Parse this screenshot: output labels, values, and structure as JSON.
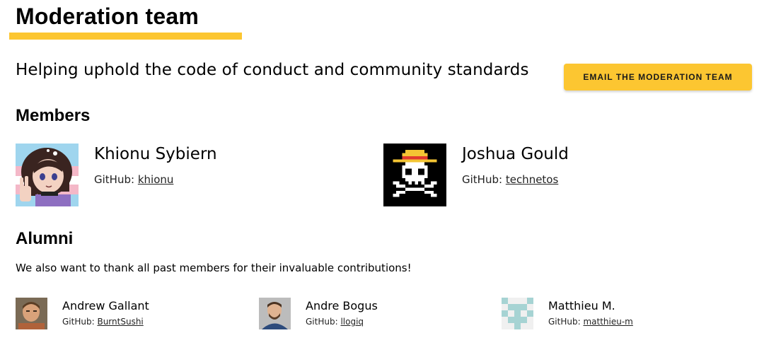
{
  "header": {
    "title": "Moderation team",
    "subtitle": "Helping uphold the code of conduct and community standards",
    "email_button_label": "EMAIL THE MODERATION TEAM"
  },
  "members": {
    "heading": "Members",
    "items": [
      {
        "name": "Khionu Sybiern",
        "github_label": "GitHub:",
        "github_user": "khionu",
        "avatar": "anime-portrait-avatar"
      },
      {
        "name": "Joshua Gould",
        "github_label": "GitHub:",
        "github_user": "technetos",
        "avatar": "pirate-skull-avatar"
      }
    ]
  },
  "alumni": {
    "heading": "Alumni",
    "intro": "We also want to thank all past members for their invaluable contributions!",
    "items": [
      {
        "name": "Andrew Gallant",
        "github_label": "GitHub:",
        "github_user": "BurntSushi",
        "avatar": "photo-avatar"
      },
      {
        "name": "Andre Bogus",
        "github_label": "GitHub:",
        "github_user": "llogiq",
        "avatar": "photo-avatar"
      },
      {
        "name": "Matthieu M.",
        "github_label": "GitHub:",
        "github_user": "matthieu-m",
        "avatar": "identicon-avatar"
      }
    ]
  },
  "colors": {
    "accent": "#fcc631",
    "identicon": "#a6d3d3"
  }
}
